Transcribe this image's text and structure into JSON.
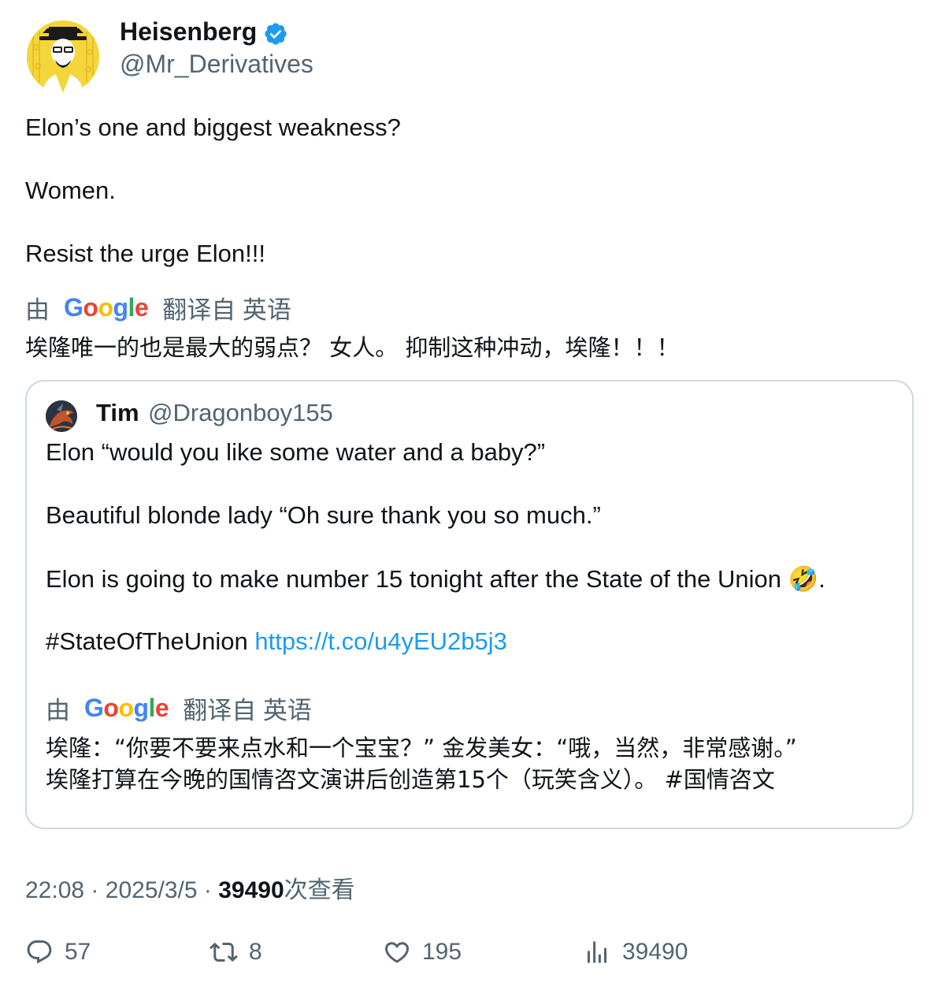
{
  "author": {
    "name": "Heisenberg",
    "handle": "@Mr_Derivatives",
    "verified_color": "#1d9bf0",
    "avatar_icon": "heisenberg-avatar"
  },
  "tweet": {
    "lines": [
      "Elon’s one and biggest weakness?",
      "Women.",
      "Resist the urge Elon!!!"
    ],
    "translation": {
      "prefix": "由",
      "provider": [
        "G",
        "o",
        "o",
        "g",
        "l",
        "e"
      ],
      "suffix": "翻译自 英语",
      "text": "埃隆唯一的也是最大的弱点？ 女人。 抑制这种冲动，埃隆！！！"
    }
  },
  "quote": {
    "name": "Tim",
    "handle": "@Dragonboy155",
    "avatar_icon": "dragon-avatar",
    "lines": [
      "Elon “would you like some water and a baby?”",
      "Beautiful blonde lady “Oh sure thank you so much.”",
      "Elon is going to make number 15 tonight after the State of the Union 🤣."
    ],
    "hashtag": "#StateOfTheUnion",
    "link": "https://t.co/u4yEU2b5j3",
    "translation": {
      "prefix": "由",
      "provider": [
        "G",
        "o",
        "o",
        "g",
        "l",
        "e"
      ],
      "suffix": "翻译自 英语",
      "text_line1": "埃隆：“你要不要来点水和一个宝宝？” 金发美女：“哦，当然，非常感谢。”",
      "text_line2": "埃隆打算在今晚的国情咨文演讲后创造第15个（玩笑含义）。 #国情咨文"
    }
  },
  "meta": {
    "time": "22:08",
    "date": "2025/3/5",
    "separator": "·",
    "views": "39490",
    "views_label": "次查看"
  },
  "actions": {
    "replies": "57",
    "reposts": "8",
    "likes": "195",
    "views": "39490"
  }
}
